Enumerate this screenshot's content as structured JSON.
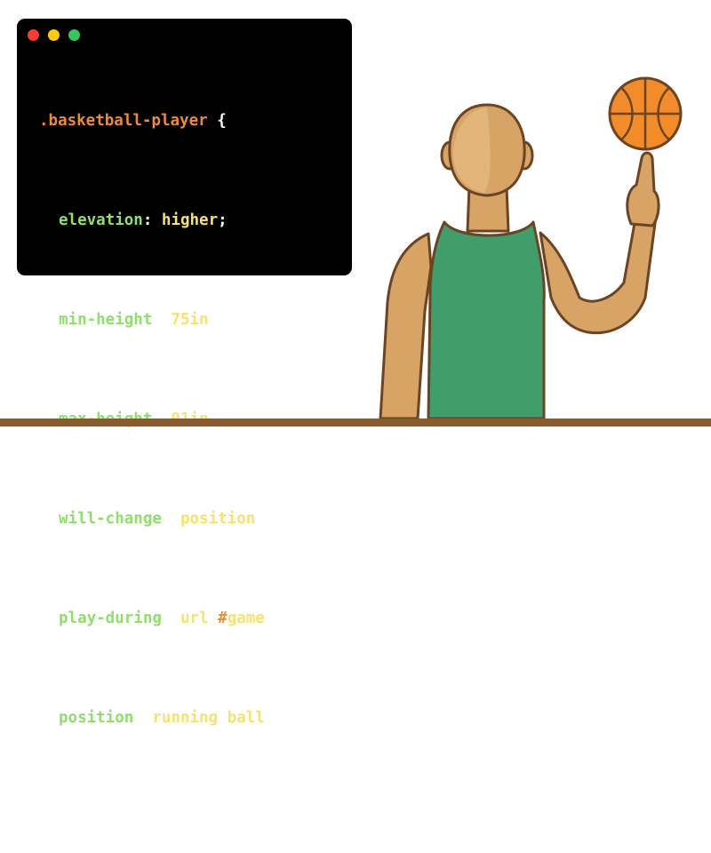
{
  "window": {
    "traffic_lights": [
      {
        "name": "close",
        "color": "#ff3b30"
      },
      {
        "name": "minimize",
        "color": "#ffcc00"
      },
      {
        "name": "maximize",
        "color": "#34c759"
      }
    ]
  },
  "code": {
    "selector": ".basketball-player",
    "open_brace": " {",
    "close_brace": "}",
    "declarations": [
      {
        "property": "elevation",
        "value": "higher"
      },
      {
        "property": "min-height",
        "value": "75in"
      },
      {
        "property": "max-height",
        "value": "91in"
      },
      {
        "property": "will-change",
        "value": "position"
      },
      {
        "property": "play-during",
        "value_fn": "url",
        "value_hash": "#",
        "value_arg": "game"
      },
      {
        "property": "position",
        "value_fn": "running",
        "value_arg": "ball"
      }
    ]
  },
  "colors": {
    "selector": "#f08b2c",
    "property": "#8ee068",
    "value": "#f7e36b",
    "skin": "#d7a466",
    "skin_light": "#e2b67a",
    "jersey": "#3f9e6b",
    "ball": "#f28c28",
    "floor": "#8b5a2b"
  }
}
